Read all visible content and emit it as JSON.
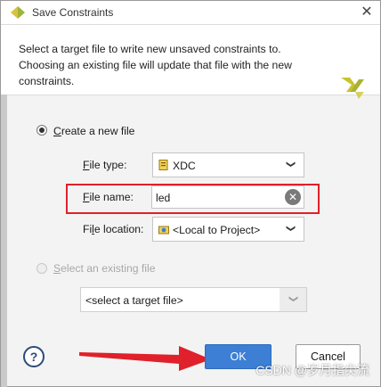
{
  "window": {
    "title": "Save Constraints"
  },
  "header": {
    "description": "Select a target file to write new unsaved constraints to. Choosing an existing file will update that file with the new constraints."
  },
  "create_new": {
    "label_prefix": "",
    "label_underline": "C",
    "label_rest": "reate a new file",
    "file_type": {
      "label_underline": "F",
      "label_rest": "ile type:",
      "value": "XDC"
    },
    "file_name": {
      "label_underline": "F",
      "label_rest": "ile name:",
      "value": "led"
    },
    "file_location": {
      "label_prefix": "Fi",
      "label_underline": "l",
      "label_rest": "e location:",
      "value": "<Local to Project>"
    }
  },
  "select_existing": {
    "label_underline": "S",
    "label_rest": "elect an existing file",
    "placeholder": "<select a target file>"
  },
  "buttons": {
    "help": "?",
    "ok": "OK",
    "cancel": "Cancel"
  },
  "watermark": "CSDN @岁月指尖流",
  "colors": {
    "accent": "#3c7fd4",
    "highlight": "#e0202a",
    "logo": "#c9c32b"
  }
}
